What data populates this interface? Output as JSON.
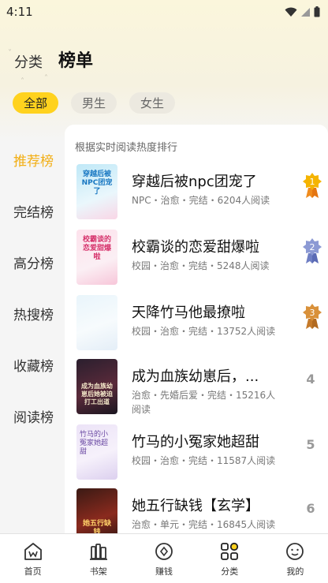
{
  "status": {
    "time": "4:11"
  },
  "header": {
    "tab_category": "分类",
    "tab_ranking": "榜单"
  },
  "filters": [
    {
      "label": "全部",
      "active": true
    },
    {
      "label": "男生",
      "active": false
    },
    {
      "label": "女生",
      "active": false
    }
  ],
  "side_nav": [
    {
      "label": "推荐榜",
      "active": true
    },
    {
      "label": "完结榜",
      "active": false
    },
    {
      "label": "高分榜",
      "active": false
    },
    {
      "label": "热搜榜",
      "active": false
    },
    {
      "label": "收藏榜",
      "active": false
    },
    {
      "label": "阅读榜",
      "active": false
    }
  ],
  "panel": {
    "subtitle": "根据实时阅读热度排行",
    "books": [
      {
        "rank": "1",
        "title": "穿越后被npc团宠了",
        "meta": "NPC・治愈・完结・6204人阅读",
        "cover_text": "穿越后被NPC团宠了",
        "badge": "gold"
      },
      {
        "rank": "2",
        "title": "校霸谈的恋爱甜爆啦",
        "meta": "校园・治愈・完结・5248人阅读",
        "cover_text": "校霸谈的恋爱甜爆啦",
        "badge": "silver"
      },
      {
        "rank": "3",
        "title": "天降竹马他最撩啦",
        "meta": "校园・治愈・完结・13752人阅读",
        "cover_text": "",
        "badge": "bronze"
      },
      {
        "rank": "4",
        "title": "成为血族幼崽后，...",
        "meta": "治愈・先婚后爱・完结・15216人阅读",
        "cover_text": "成为血族幼崽后她被迫打工出道",
        "badge": ""
      },
      {
        "rank": "5",
        "title": "竹马的小冤家她超甜",
        "meta": "校园・治愈・完结・11587人阅读",
        "cover_text": "竹马的小冤家她超甜",
        "badge": ""
      },
      {
        "rank": "6",
        "title": "她五行缺钱【玄学】",
        "meta": "治愈・单元・完结・16845人阅读",
        "cover_text": "她五行缺钱",
        "badge": ""
      }
    ]
  },
  "bottom_nav": [
    {
      "label": "首页",
      "icon": "home-icon",
      "active": false
    },
    {
      "label": "书架",
      "icon": "bookshelf-icon",
      "active": false
    },
    {
      "label": "赚钱",
      "icon": "earn-icon",
      "active": false
    },
    {
      "label": "分类",
      "icon": "category-icon",
      "active": true
    },
    {
      "label": "我的",
      "icon": "profile-icon",
      "active": false
    }
  ],
  "colors": {
    "accent": "#ffd21e",
    "active_side": "#f2ae14",
    "gold": "#f5b400",
    "silver": "#8c9ad4",
    "bronze": "#d9913a"
  }
}
